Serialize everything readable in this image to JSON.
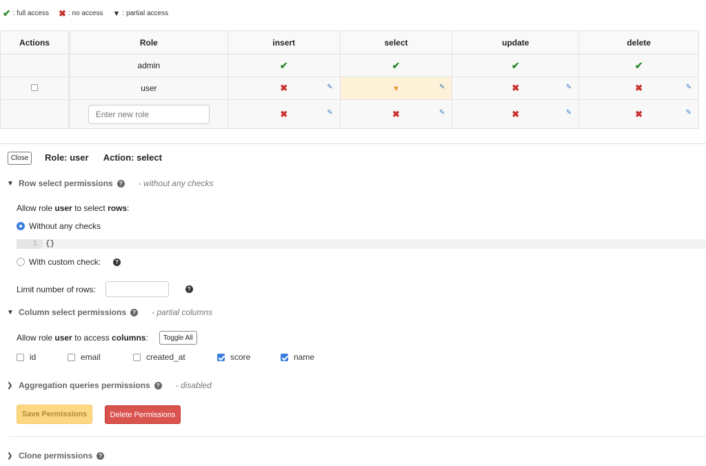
{
  "legend": {
    "full": "full access",
    "none": "no access",
    "partial": "partial access"
  },
  "table": {
    "headers": {
      "actions": "Actions",
      "role": "Role",
      "insert": "insert",
      "select": "select",
      "update": "update",
      "delete": "delete"
    },
    "rows": [
      {
        "role": "admin",
        "insert": "full",
        "select": "full",
        "update": "full",
        "delete": "full"
      },
      {
        "role": "user",
        "insert": "none",
        "select": "partial",
        "update": "none",
        "delete": "none"
      }
    ],
    "new_role_placeholder": "Enter new role"
  },
  "panel": {
    "close_label": "Close",
    "role_title": "Role: user",
    "action_title": "Action: select",
    "row_section": {
      "title": "Row select permissions",
      "note": "- without any checks",
      "allow_prefix": "Allow role",
      "allow_role": "user",
      "allow_mid": "to select",
      "allow_target": "rows",
      "allow_suffix": ":",
      "option_without": "Without any checks",
      "option_custom": "With custom check:",
      "code_line_no": "1",
      "code_text": "{}",
      "limit_label": "Limit number of rows:",
      "selected_option": "without"
    },
    "column_section": {
      "title": "Column select permissions",
      "note": "- partial columns",
      "allow_prefix": "Allow role",
      "allow_role": "user",
      "allow_mid": "to access",
      "allow_target": "columns",
      "allow_suffix": ":",
      "toggle_all": "Toggle All",
      "columns": [
        {
          "name": "id",
          "checked": false
        },
        {
          "name": "email",
          "checked": false
        },
        {
          "name": "created_at",
          "checked": false
        },
        {
          "name": "score",
          "checked": true
        },
        {
          "name": "name",
          "checked": true
        }
      ]
    },
    "aggregation_section": {
      "title": "Aggregation queries permissions",
      "note": "- disabled"
    },
    "save_label": "Save Permissions",
    "delete_label": "Delete Permissions",
    "clone_section": {
      "title": "Clone permissions"
    }
  },
  "colors": {
    "full": "#2e8b2e",
    "none": "#c9302c",
    "partial": "#e8942a",
    "highlight": "#fdf1d8",
    "accent": "#3a7fde"
  }
}
